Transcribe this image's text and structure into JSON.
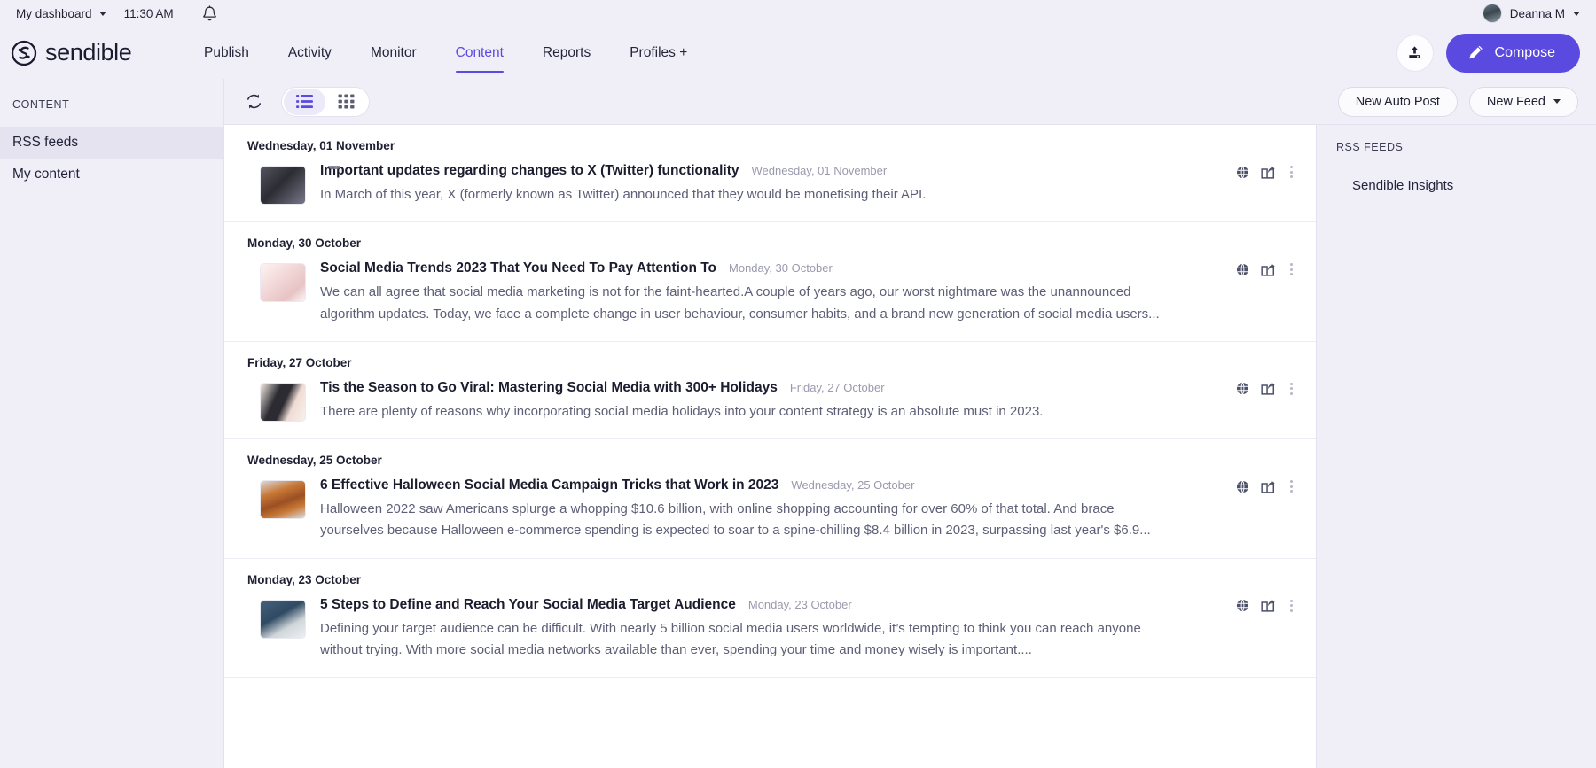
{
  "utilbar": {
    "dashboard_label": "My dashboard",
    "time": "11:30 AM",
    "bell_icon": "bell-icon",
    "user_name": "Deanna M"
  },
  "nav": {
    "brand": "sendible",
    "links": [
      {
        "label": "Publish",
        "active": false
      },
      {
        "label": "Activity",
        "active": false
      },
      {
        "label": "Monitor",
        "active": false
      },
      {
        "label": "Content",
        "active": true
      },
      {
        "label": "Reports",
        "active": false
      },
      {
        "label": "Profiles +",
        "active": false
      }
    ],
    "upload_icon": "upload-icon",
    "compose_label": "Compose",
    "compose_icon": "pencil-icon",
    "accent_color": "#5b4ae0"
  },
  "sidebar": {
    "heading": "CONTENT",
    "items": [
      {
        "label": "RSS feeds",
        "active": true
      },
      {
        "label": "My content",
        "active": false
      }
    ]
  },
  "toolbar": {
    "refresh_icon": "refresh-icon",
    "list_view_label": "list-view",
    "grid_view_label": "grid-view",
    "active_view": "list",
    "new_auto_post_label": "New Auto Post",
    "new_feed_label": "New Feed"
  },
  "feed": {
    "groups": [
      {
        "day": "Wednesday, 01 November",
        "posts": [
          {
            "title": "Important updates regarding changes to X (Twitter) functionality",
            "date": "Wednesday, 01 November",
            "excerpt": "In March of this year, X (formerly known as Twitter) announced that they would be monetising their API.",
            "thumb_colors": [
              "#4b4b55",
              "#2c2c33",
              "#6c6c78"
            ]
          }
        ]
      },
      {
        "day": "Monday, 30 October",
        "posts": [
          {
            "title": "Social Media Trends 2023 That You Need To Pay Attention To",
            "date": "Monday, 30 October",
            "excerpt": "We can all agree that social media marketing is not for the faint-hearted.A couple of years ago, our worst nightmare was the unannounced algorithm updates. Today, we face a complete change in user behaviour, consumer habits, and a brand new generation of social media users...",
            "thumb_colors": [
              "#f6dede",
              "#eec8c8",
              "#fdf6f4"
            ]
          }
        ]
      },
      {
        "day": "Friday, 27 October",
        "posts": [
          {
            "title": "Tis the Season to Go Viral: Mastering Social Media with 300+ Holidays",
            "date": "Friday, 27 October",
            "excerpt": "There are plenty of reasons why incorporating social media holidays into your content strategy is an absolute must in 2023.",
            "thumb_colors": [
              "#2d2d33",
              "#efe0da",
              "#f7ece6"
            ]
          }
        ]
      },
      {
        "day": "Wednesday, 25 October",
        "posts": [
          {
            "title": "6 Effective Halloween Social Media Campaign Tricks that Work in 2023",
            "date": "Wednesday, 25 October",
            "excerpt": "Halloween 2022 saw Americans splurge a whopping $10.6 billion, with online shopping accounting for over 60% of that total. And brace yourselves because Halloween e-commerce spending is expected to soar to a spine-chilling $8.4 billion in 2023, surpassing last year's $6.9...",
            "thumb_colors": [
              "#b5652a",
              "#e0e0e6",
              "#7c3f1d"
            ]
          }
        ]
      },
      {
        "day": "Monday, 23 October",
        "posts": [
          {
            "title": "5 Steps to Define and Reach Your Social Media Target Audience",
            "date": "Monday, 23 October",
            "excerpt": "Defining your target audience can be difficult. With nearly 5 billion social media users worldwide, it’s tempting to think you can reach anyone without trying.  With more social media networks available than ever, spending your time and money wisely is important....",
            "thumb_colors": [
              "#2f4a63",
              "#e8eaec",
              "#5d7f9c"
            ]
          }
        ]
      }
    ],
    "action_icons": {
      "globe": "globe-icon",
      "share": "share-icon",
      "more": "more-vertical-icon"
    }
  },
  "rss_panel": {
    "heading": "RSS FEEDS",
    "items": [
      {
        "label": "Sendible Insights"
      }
    ]
  }
}
